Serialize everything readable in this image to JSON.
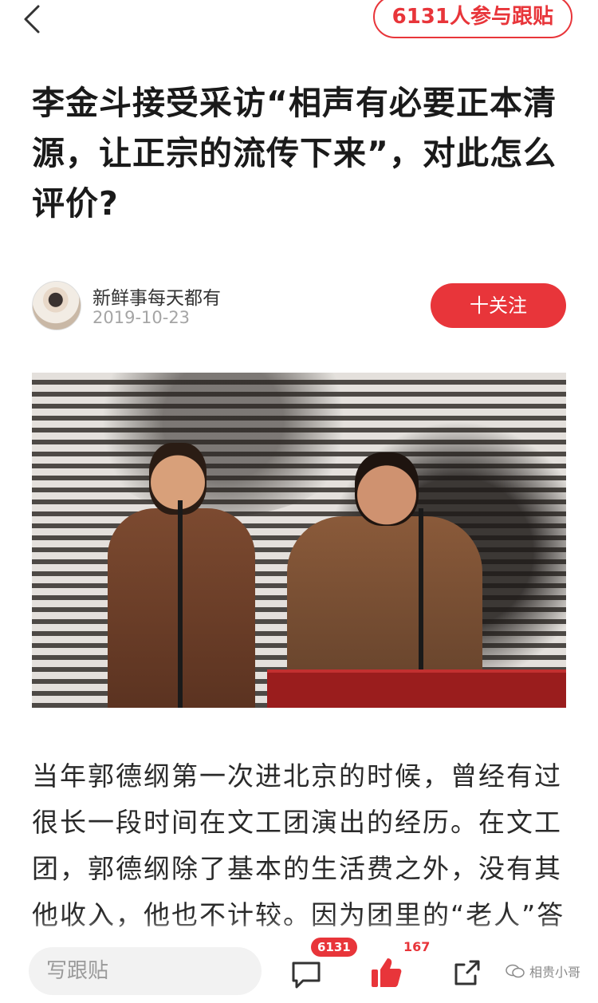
{
  "header": {
    "participants_label": "6131人参与跟贴"
  },
  "article": {
    "title": "李金斗接受采访“相声有必要正本清源，让正宗的流传下来”，对此怎么评价?",
    "author": {
      "name": "新鲜事每天都有",
      "date": "2019-10-23"
    },
    "follow_label": "十关注",
    "body": "当年郭德纲第一次进北京的时候，曾经有过很长一段时间在文工团演出的经历。在文工团，郭德纲除了基本的生活费之外，没有其他收入，他也不计较。因为团里的“老人”答应"
  },
  "bottom_bar": {
    "comment_placeholder": "写跟贴",
    "comment_count": "6131",
    "like_count": "167",
    "watermark": "相贵小哥"
  },
  "colors": {
    "accent": "#e8353a"
  },
  "icons": [
    "back-arrow-icon",
    "comment-bubble-icon",
    "thumbs-up-icon",
    "share-icon",
    "wechat-logo-icon"
  ]
}
